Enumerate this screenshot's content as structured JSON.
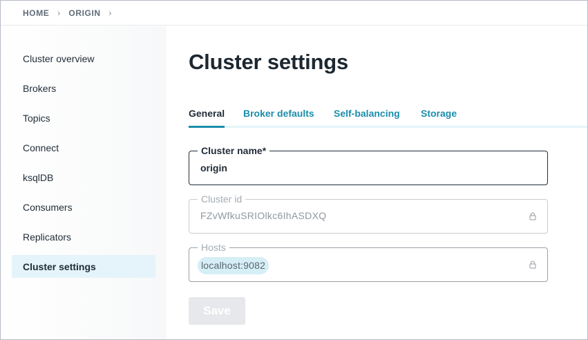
{
  "breadcrumb": {
    "home": "HOME",
    "current": "ORIGIN",
    "separator": "›"
  },
  "sidebar": {
    "items": [
      {
        "label": "Cluster overview",
        "active": false
      },
      {
        "label": "Brokers",
        "active": false
      },
      {
        "label": "Topics",
        "active": false
      },
      {
        "label": "Connect",
        "active": false
      },
      {
        "label": "ksqlDB",
        "active": false
      },
      {
        "label": "Consumers",
        "active": false
      },
      {
        "label": "Replicators",
        "active": false
      },
      {
        "label": "Cluster settings",
        "active": true
      }
    ]
  },
  "main": {
    "title": "Cluster settings",
    "tabs": [
      {
        "label": "General",
        "active": true
      },
      {
        "label": "Broker defaults",
        "active": false
      },
      {
        "label": "Self-balancing",
        "active": false
      },
      {
        "label": "Storage",
        "active": false
      }
    ],
    "fields": {
      "cluster_name": {
        "label": "Cluster name*",
        "value": "origin"
      },
      "cluster_id": {
        "label": "Cluster id",
        "value": "FZvWfkuSRIOlkc6IhASDXQ"
      },
      "hosts": {
        "label": "Hosts",
        "chips": [
          "localhost:9082"
        ]
      }
    },
    "save_label": "Save"
  },
  "colors": {
    "accent": "#1a8dab",
    "active_nav_bg": "#e4f4fa",
    "chip_bg": "#d6eef6",
    "text": "#1f2b37",
    "disabled_button": "#e6e8eb"
  },
  "icons": {
    "breadcrumb_separator": "chevron-right-icon",
    "readonly_field": "lock-icon"
  }
}
